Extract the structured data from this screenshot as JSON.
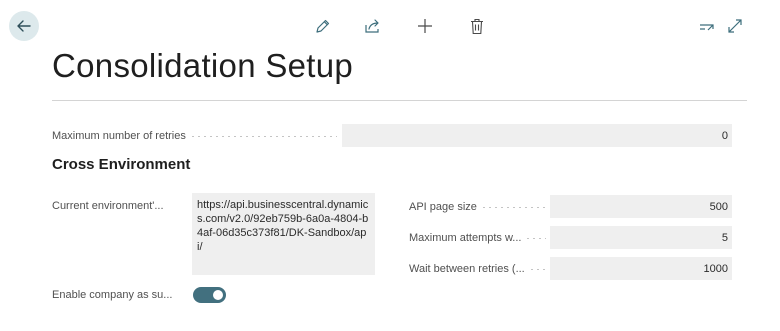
{
  "page": {
    "title": "Consolidation Setup"
  },
  "general": {
    "max_retries": {
      "label": "Maximum number of retries",
      "value": "0"
    }
  },
  "cross_environment": {
    "section_title": "Cross Environment",
    "current_environment": {
      "label": "Current environment'...",
      "value": "https://api.businesscentral.dynamics.com/v2.0/92eb759b-6a0a-4804-b4af-06d35c373f81/DK-Sandbox/api/"
    },
    "enable_company": {
      "label": "Enable company as su...",
      "value": true
    },
    "api_page_size": {
      "label": "API page size",
      "value": "500"
    },
    "max_attempts": {
      "label": "Maximum attempts w...",
      "value": "5"
    },
    "wait_between_retries": {
      "label": "Wait between retries (...",
      "value": "1000"
    }
  },
  "icons": {
    "back": "arrow-left-icon",
    "edit": "pencil-icon",
    "share": "share-icon",
    "new": "plus-icon",
    "delete": "trash-icon",
    "collapse": "collapse-icon",
    "expand": "expand-icon"
  },
  "colors": {
    "toggle_on": "#42707f",
    "back_button_bg": "#dde9ec",
    "icon": "#3d6e7c"
  }
}
